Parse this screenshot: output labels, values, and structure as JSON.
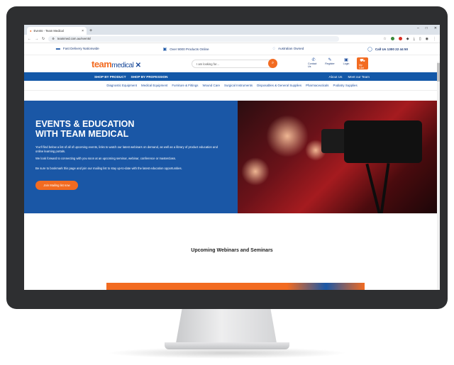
{
  "browser": {
    "tab_title": "Events - Team Medical",
    "url": "teammed.com.au/events/",
    "new_tab": "+",
    "window_controls": [
      "–",
      "□",
      "✕"
    ]
  },
  "infobar": {
    "items": [
      "Fast Delivery Nationwide",
      "Over 9000 Products Online",
      "Australian Owned"
    ],
    "call": "Call Us 1300 22 44 50"
  },
  "header": {
    "logo_team": "team",
    "logo_medical": "medical",
    "search_placeholder": "I am looking for...",
    "icons": [
      {
        "label": "Contact Us",
        "icon": "phone-icon"
      },
      {
        "label": "Register",
        "icon": "register-icon"
      },
      {
        "label": "Login",
        "icon": "user-icon"
      },
      {
        "label": "My Cart",
        "icon": "cart-icon"
      }
    ]
  },
  "nav": {
    "left": [
      "SHOP BY PRODUCT",
      "SHOP BY PROFESSION"
    ],
    "right": [
      "About Us",
      "Meet our Team"
    ]
  },
  "categories": [
    "Diagnostic Equipment",
    "Medical Equipment",
    "Furniture & Fittings",
    "Wound Care",
    "Surgical Instruments",
    "Disposables & General Supplies",
    "Pharmaceuticals",
    "Podiatry Supplies"
  ],
  "hero": {
    "title": "EVENTS & EDUCATION WITH TEAM MEDICAL",
    "p1": "You'll find below a list of all of upcoming events, links to watch our latest webinars on demand, as well as a library of product education and online learning portals.",
    "p2": "We look forward to connecting with you soon at an upcoming seminar, webinar, conference or masterclass.",
    "p3": "Be sure to bookmark this page and join our mailing list to stay up-to-date with the latest education opportunities.",
    "button": "Join Mailing list now"
  },
  "section": {
    "title": "Upcoming Webinars and Seminars"
  }
}
